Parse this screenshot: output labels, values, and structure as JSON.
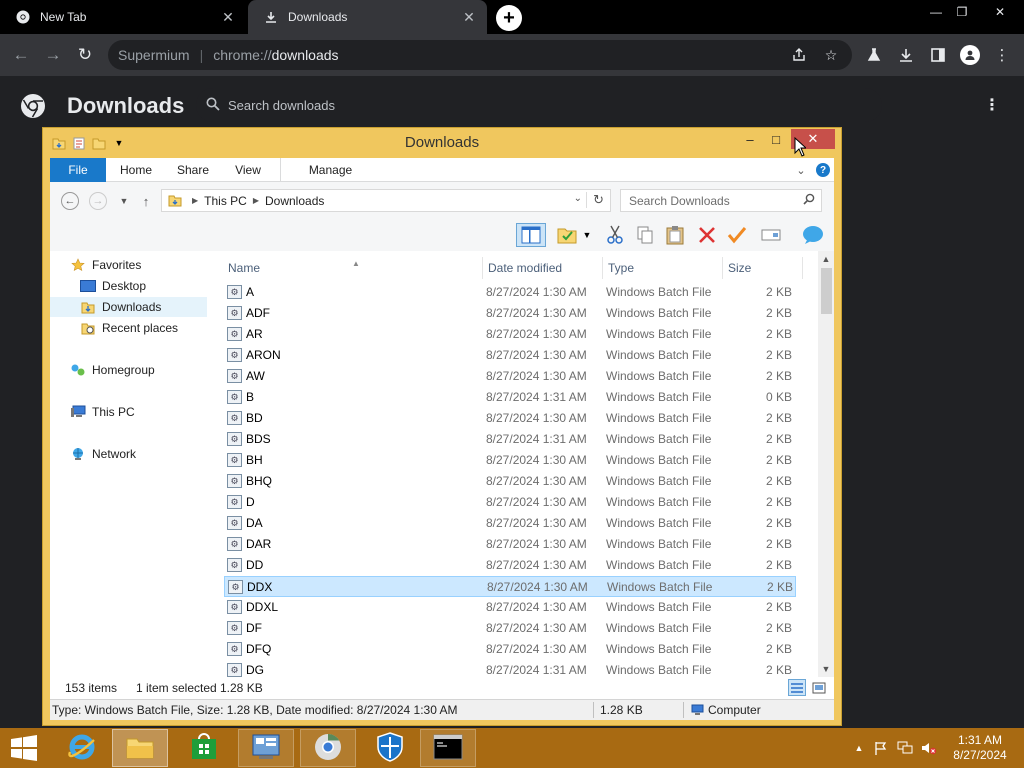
{
  "browser": {
    "tabs": [
      {
        "label": "New Tab",
        "close": "✕"
      },
      {
        "label": "Downloads",
        "close": "✕"
      }
    ],
    "new_tab": "+",
    "window_controls": {
      "minimize": "—",
      "restore": "❐",
      "close": "✕"
    },
    "nav": {
      "back": "←",
      "forward": "→",
      "reload": "↻"
    },
    "omnibox": {
      "site": "Supermium",
      "separator": "|",
      "scheme": "chrome://",
      "path": "downloads"
    },
    "icons": [
      "share-icon",
      "bookmark-star-icon",
      "labs-icon",
      "download-icon",
      "side-panel-icon",
      "profile-icon",
      "menu-icon"
    ]
  },
  "downloads_page": {
    "title": "Downloads",
    "search_placeholder": "Search downloads",
    "menu": "⋮"
  },
  "explorer": {
    "title": "Downloads",
    "controls": {
      "minimize": "–",
      "maximize": "□",
      "close": "✕"
    },
    "ribbon_tabs": [
      "File",
      "Home",
      "Share",
      "View",
      "Manage"
    ],
    "address": {
      "crumbs": [
        "This PC",
        "Downloads"
      ],
      "search_placeholder": "Search Downloads"
    },
    "nav_pane": {
      "favorites": "Favorites",
      "favorites_items": [
        "Desktop",
        "Downloads",
        "Recent places"
      ],
      "homegroup": "Homegroup",
      "this_pc": "This PC",
      "network": "Network"
    },
    "columns": {
      "name": "Name",
      "date": "Date modified",
      "type": "Type",
      "size": "Size"
    },
    "files": [
      {
        "name": "A",
        "date": "8/27/2024 1:30 AM",
        "type": "Windows Batch File",
        "size": "2 KB"
      },
      {
        "name": "ADF",
        "date": "8/27/2024 1:30 AM",
        "type": "Windows Batch File",
        "size": "2 KB"
      },
      {
        "name": "AR",
        "date": "8/27/2024 1:30 AM",
        "type": "Windows Batch File",
        "size": "2 KB"
      },
      {
        "name": "ARON",
        "date": "8/27/2024 1:30 AM",
        "type": "Windows Batch File",
        "size": "2 KB"
      },
      {
        "name": "AW",
        "date": "8/27/2024 1:30 AM",
        "type": "Windows Batch File",
        "size": "2 KB"
      },
      {
        "name": "B",
        "date": "8/27/2024 1:31 AM",
        "type": "Windows Batch File",
        "size": "0 KB"
      },
      {
        "name": "BD",
        "date": "8/27/2024 1:30 AM",
        "type": "Windows Batch File",
        "size": "2 KB"
      },
      {
        "name": "BDS",
        "date": "8/27/2024 1:31 AM",
        "type": "Windows Batch File",
        "size": "2 KB"
      },
      {
        "name": "BH",
        "date": "8/27/2024 1:30 AM",
        "type": "Windows Batch File",
        "size": "2 KB"
      },
      {
        "name": "BHQ",
        "date": "8/27/2024 1:30 AM",
        "type": "Windows Batch File",
        "size": "2 KB"
      },
      {
        "name": "D",
        "date": "8/27/2024 1:30 AM",
        "type": "Windows Batch File",
        "size": "2 KB"
      },
      {
        "name": "DA",
        "date": "8/27/2024 1:30 AM",
        "type": "Windows Batch File",
        "size": "2 KB"
      },
      {
        "name": "DAR",
        "date": "8/27/2024 1:30 AM",
        "type": "Windows Batch File",
        "size": "2 KB"
      },
      {
        "name": "DD",
        "date": "8/27/2024 1:30 AM",
        "type": "Windows Batch File",
        "size": "2 KB"
      },
      {
        "name": "DDX",
        "date": "8/27/2024 1:30 AM",
        "type": "Windows Batch File",
        "size": "2 KB",
        "selected": true
      },
      {
        "name": "DDXL",
        "date": "8/27/2024 1:30 AM",
        "type": "Windows Batch File",
        "size": "2 KB"
      },
      {
        "name": "DF",
        "date": "8/27/2024 1:30 AM",
        "type": "Windows Batch File",
        "size": "2 KB"
      },
      {
        "name": "DFQ",
        "date": "8/27/2024 1:30 AM",
        "type": "Windows Batch File",
        "size": "2 KB"
      },
      {
        "name": "DG",
        "date": "8/27/2024 1:31 AM",
        "type": "Windows Batch File",
        "size": "2 KB"
      }
    ],
    "status": {
      "count": "153 items",
      "selected": "1 item selected",
      "size": "1.28 KB"
    },
    "details": {
      "info": "Type: Windows Batch File, Size: 1.28 KB, Date modified: 8/27/2024 1:30 AM",
      "size": "1.28 KB",
      "location": "Computer"
    }
  },
  "taskbar": {
    "apps": [
      "internet-explorer-icon",
      "file-explorer-icon",
      "store-icon",
      "control-panel-icon",
      "chrome-icon",
      "defender-icon",
      "cmd-icon"
    ],
    "tray_arrow": "▲",
    "clock": {
      "time": "1:31 AM",
      "date": "8/27/2024"
    }
  },
  "colors": {
    "taskbar": "#a86a12",
    "explorer_frame": "#f0c75e",
    "ribbon_file": "#1979ca",
    "chrome_dark": "#202124"
  }
}
